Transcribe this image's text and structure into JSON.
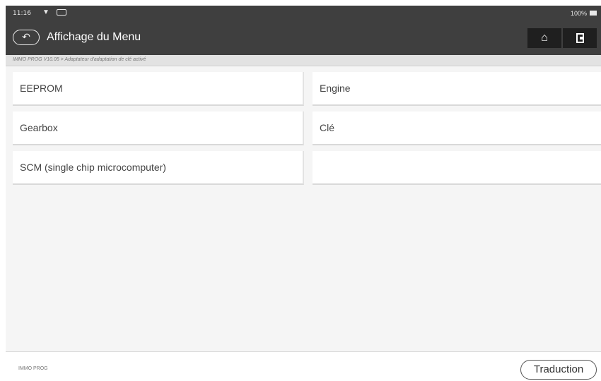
{
  "status": {
    "time": "11:16",
    "wifi_icon": "wifi-icon",
    "notification_icon": "notification-icon",
    "battery": "100%"
  },
  "header": {
    "back_icon": "back-icon",
    "title": "Affichage du Menu",
    "home_icon": "home-icon",
    "exit_icon": "exit-icon"
  },
  "breadcrumb": "IMMO PROG V10.05 > Adaptateur d'adaptation de clé activé",
  "menu": {
    "items": [
      {
        "label": "EEPROM"
      },
      {
        "label": "Engine"
      },
      {
        "label": "Gearbox"
      },
      {
        "label": "Clé"
      },
      {
        "label": "SCM (single chip microcomputer)"
      },
      {
        "label": ""
      }
    ]
  },
  "footer": {
    "label": "IMMO PROG",
    "translate_label": "Traduction"
  },
  "colors": {
    "topbar": "#3f3f3f",
    "button_dark": "#1f1f1f",
    "content_bg": "#f5f5f5"
  }
}
